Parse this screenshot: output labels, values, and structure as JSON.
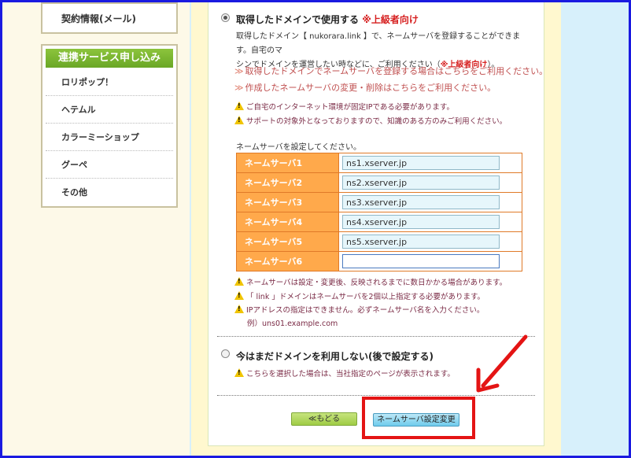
{
  "sidebar": {
    "contract_item": "契約情報(メール)",
    "service_header": "連携サービス申し込み",
    "items": [
      {
        "label": "ロリポップ！"
      },
      {
        "label": "ヘテムル"
      },
      {
        "label": "カラーミーショップ"
      },
      {
        "label": "グーペ"
      },
      {
        "label": "その他"
      }
    ]
  },
  "option_use": {
    "title": "取得したドメインで使用する",
    "advanced_tag": "※上級者向け",
    "desc_line1": "取得したドメイン【 nukorara.link 】で、ネームサーバを登録することができます。自宅のマ",
    "desc_line2_prefix": "シンでドメインを運営したい時などに、ご利用ください（",
    "desc_line2_tag": "※上級者向け",
    "desc_line2_suffix": "）。",
    "link1": "取得したドメインでネームサーバを登録する場合はこちらをご利用ください。",
    "link2": "作成したネームサーバの変更・削除はこちらをご利用ください。",
    "link_mark": "≫",
    "warnings": [
      "ご自宅のインターネット環境が固定IPである必要があります。",
      "サポートの対象外となっておりますので、知識のある方のみご利用ください。"
    ]
  },
  "nameservers": {
    "prompt": "ネームサーバを設定してください。",
    "rows": [
      {
        "label": "ネームサーバ1",
        "value": "ns1.xserver.jp"
      },
      {
        "label": "ネームサーバ2",
        "value": "ns2.xserver.jp"
      },
      {
        "label": "ネームサーバ3",
        "value": "ns3.xserver.jp"
      },
      {
        "label": "ネームサーバ4",
        "value": "ns4.xserver.jp"
      },
      {
        "label": "ネームサーバ5",
        "value": "ns5.xserver.jp"
      },
      {
        "label": "ネームサーバ6",
        "value": ""
      }
    ],
    "notes": [
      "ネームサーバは設定・変更後、反映されるまでに数日かかる場合があります。",
      "「 link 」ドメインはネームサーバを2個以上指定する必要があります。",
      "IPアドレスの指定はできません。必ずネームサーバ名を入力ください。"
    ],
    "example": "例）uns01.example.com"
  },
  "option_later": {
    "title": "今はまだドメインを利用しない(後で設定する)",
    "warning": "こちらを選択した場合は、当社指定のページが表示されます。"
  },
  "buttons": {
    "back": "≪もどる",
    "submit": "ネームサーバ設定変更"
  },
  "colors": {
    "accent_green": "#8cc43c",
    "table_header": "#ffa94b",
    "highlight_red": "#e41414",
    "frame_blue": "#1a1ae0"
  }
}
